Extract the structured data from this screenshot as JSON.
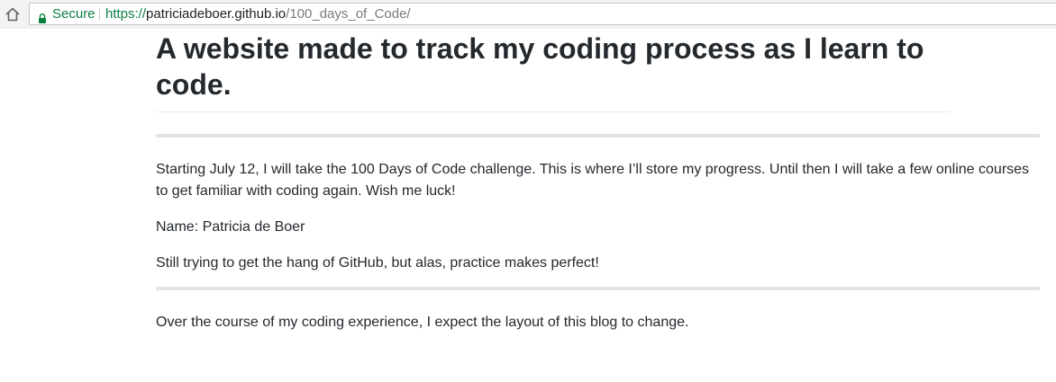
{
  "browser": {
    "home_icon": "home-icon",
    "lock_icon": "lock-icon",
    "secure_label": "Secure",
    "url_scheme": "https://",
    "url_host": "patriciadeboer.github.io",
    "url_path": "/100_days_of_Code/",
    "secure_color": "#0b8043"
  },
  "page": {
    "title": "A website made to track my coding process as I learn to code.",
    "paragraphs": [
      "Starting July 12, I will take the 100 Days of Code challenge. This is where I’ll store my progress. Until then I will take a few online courses to get familiar with coding again. Wish me luck!",
      "Name: Patricia de Boer",
      "Still trying to get the hang of GitHub, but alas, practice makes perfect!",
      "Over the course of my coding experience, I expect the layout of this blog to change."
    ]
  }
}
